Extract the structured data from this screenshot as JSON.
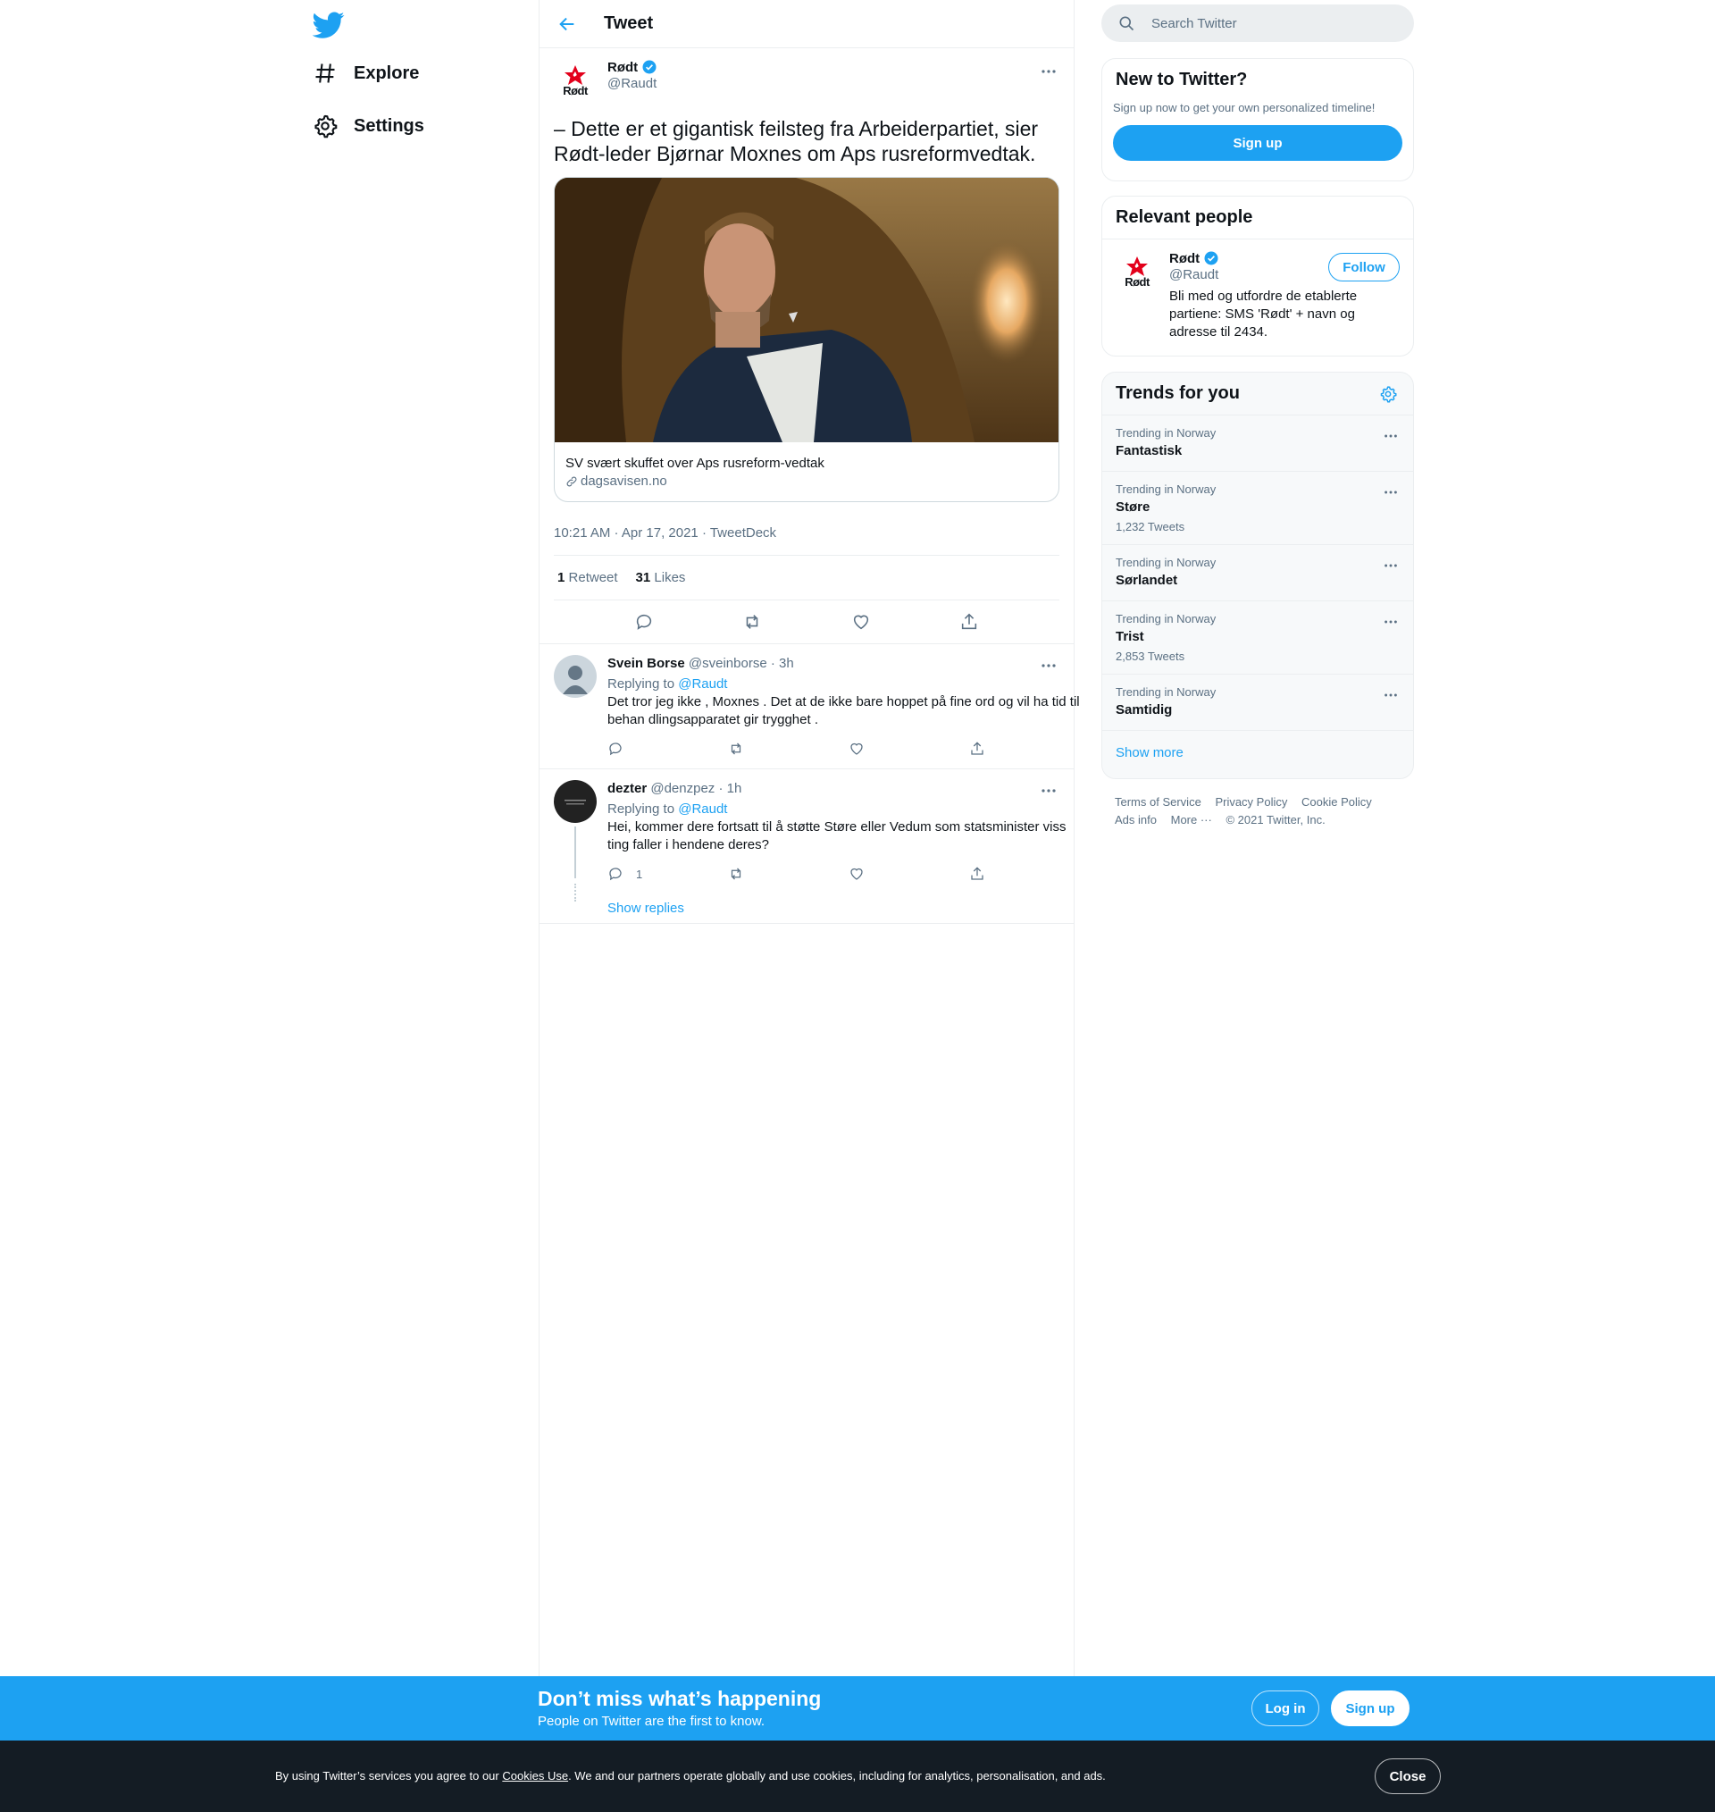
{
  "nav": {
    "explore": "Explore",
    "settings": "Settings"
  },
  "header": {
    "title": "Tweet"
  },
  "tweet": {
    "author_name": "Rødt",
    "author_handle": "@Raudt",
    "avatar_text": "Rødt",
    "text": "– Dette er et gigantisk feilsteg fra Arbeiderpartiet, sier Rødt-leder Bjørnar Moxnes om Aps rusreformvedtak.",
    "card_title": "SV svært skuffet over Aps rusreform-vedtak",
    "card_domain": "dagsavisen.no",
    "meta": "10:21 AM · Apr 17, 2021 · TweetDeck",
    "retweet_count": "1",
    "retweet_label": "Retweet",
    "like_count": "31",
    "like_label": "Likes"
  },
  "replies": [
    {
      "name": "Svein Borse",
      "handle_time": "@sveinborse · 3h",
      "replying_prefix": "Replying to",
      "replying_to": "@Raudt",
      "text": "Det tror jeg ikke , Moxnes . Det at de ikke bare hoppet på fine ord og vil ha tid til behan dlingsapparatet gir trygghet .",
      "reply_count": ""
    },
    {
      "name": "dezter",
      "handle_time": "@denzpez · 1h",
      "replying_prefix": "Replying to",
      "replying_to": "@Raudt",
      "text": "Hei, kommer dere fortsatt til å støtte Støre eller Vedum som statsminister viss ting faller i hendene deres?",
      "reply_count": "1",
      "show_replies": "Show replies"
    }
  ],
  "search": {
    "placeholder": "Search Twitter"
  },
  "new_to_twitter": {
    "title": "New to Twitter?",
    "subtitle": "Sign up now to get your own personalized timeline!",
    "signup": "Sign up"
  },
  "relevant": {
    "title": "Relevant people",
    "name": "Rødt",
    "handle": "@Raudt",
    "follow": "Follow",
    "bio": "Bli med og utfordre de etablerte partiene: SMS 'Rødt' + navn og adresse til 2434."
  },
  "trends": {
    "title": "Trends for you",
    "items": [
      {
        "context": "Trending in Norway",
        "name": "Fantastisk",
        "count": ""
      },
      {
        "context": "Trending in Norway",
        "name": "Støre",
        "count": "1,232 Tweets"
      },
      {
        "context": "Trending in Norway",
        "name": "Sørlandet",
        "count": ""
      },
      {
        "context": "Trending in Norway",
        "name": "Trist",
        "count": "2,853 Tweets"
      },
      {
        "context": "Trending in Norway",
        "name": "Samtidig",
        "count": ""
      }
    ],
    "show_more": "Show more"
  },
  "footer": {
    "terms": "Terms of Service",
    "privacy": "Privacy Policy",
    "cookie": "Cookie Policy",
    "ads": "Ads info",
    "more": "More ···",
    "copyright": "© 2021 Twitter, Inc."
  },
  "banner": {
    "title": "Don’t miss what’s happening",
    "subtitle": "People on Twitter are the first to know.",
    "login": "Log in",
    "signup": "Sign up"
  },
  "cookie": {
    "prefix": "By using Twitter’s services you agree to our",
    "link": "Cookies Use",
    "suffix": ". We and our partners operate globally and use cookies, including for analytics, personalisation, and ads.",
    "close": "Close"
  },
  "colors": {
    "accent": "#1da1f2",
    "text": "#0f1419",
    "secondary": "#5b7083",
    "cookie_bg": "#141c24",
    "rodt_red": "#e3001b"
  },
  "icons": [
    "twitter-logo-icon",
    "hashtag-icon",
    "gear-icon",
    "back-arrow-icon",
    "verified-icon",
    "more-icon",
    "reply-icon",
    "retweet-icon",
    "like-icon",
    "share-icon",
    "link-icon",
    "search-icon"
  ]
}
